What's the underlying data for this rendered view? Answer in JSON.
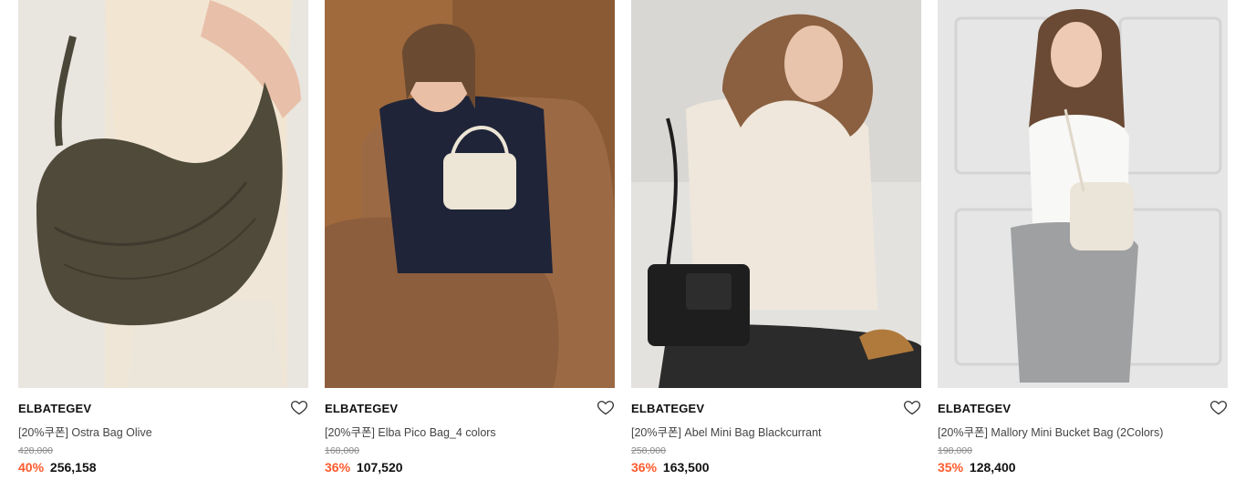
{
  "products": [
    {
      "brand": "ELBATEGEV",
      "name": "[20%쿠폰] Ostra Bag Olive",
      "original_price": "428,000",
      "discount": "40%",
      "price": "256,158"
    },
    {
      "brand": "ELBATEGEV",
      "name": "[20%쿠폰] Elba Pico Bag_4 colors",
      "original_price": "168,000",
      "discount": "36%",
      "price": "107,520"
    },
    {
      "brand": "ELBATEGEV",
      "name": "[20%쿠폰] Abel Mini Bag Blackcurrant",
      "original_price": "258,000",
      "discount": "36%",
      "price": "163,500"
    },
    {
      "brand": "ELBATEGEV",
      "name": "[20%쿠폰] Mallory Mini Bucket Bag (2Colors)",
      "original_price": "198,000",
      "discount": "35%",
      "price": "128,400"
    }
  ],
  "colors": {
    "discount": "#ff5a2c",
    "text": "#111111",
    "muted": "#888888"
  },
  "icons": {
    "wishlist": "heart-outline-icon"
  }
}
